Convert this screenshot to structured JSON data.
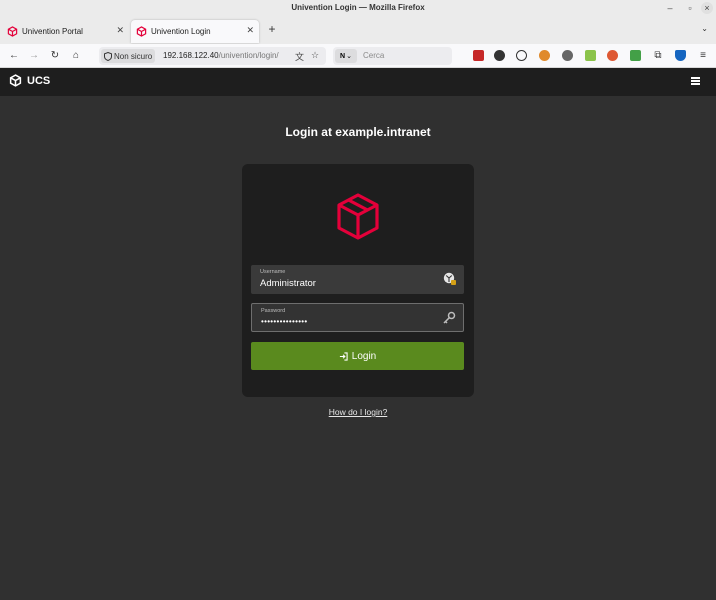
{
  "window": {
    "title": "Univention Login — Mozilla Firefox"
  },
  "tabs": [
    {
      "label": "Univention Portal"
    },
    {
      "label": "Univention Login"
    }
  ],
  "navbar": {
    "security_label": "Non sicuro",
    "url_host": "192.168.122.40",
    "url_path": "/univention/login/",
    "search_placeholder": "Cerca"
  },
  "app": {
    "brand": "UCS"
  },
  "login": {
    "title": "Login at example.intranet",
    "username_label": "Username",
    "username_value": "Administrator",
    "password_label": "Password",
    "password_value": "•••••••••••••••",
    "button_label": "Login",
    "help_link": "How do I login?"
  },
  "colors": {
    "background": "#303030",
    "card": "#1e1e1e",
    "accent_button": "#5a8a1e",
    "logo_red": "#e4003a"
  }
}
